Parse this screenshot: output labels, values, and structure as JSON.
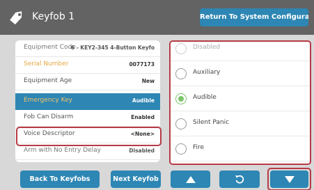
{
  "header": {
    "title": "Keyfob 1",
    "icon": "keyfob-tag-icon",
    "return_label": "Return To System Configuration"
  },
  "details": {
    "rows": [
      {
        "label": "Equipment Code",
        "value": "6 - KEY2-345 4-Button Keyfo"
      },
      {
        "label": "Serial Number",
        "value": "0077173"
      },
      {
        "label": "Equipment Age",
        "value": "New"
      },
      {
        "label": "Emergency Key",
        "value": "Audible"
      },
      {
        "label": "Fob Can Disarm",
        "value": "Enabled"
      },
      {
        "label": "Voice Descriptor",
        "value": "<None>"
      },
      {
        "label": "Arm with No Entry Delay",
        "value": "Disabled"
      }
    ]
  },
  "options": {
    "items": [
      {
        "label": "Disabled",
        "selected": false
      },
      {
        "label": "Auxiliary",
        "selected": false
      },
      {
        "label": "Audible",
        "selected": true
      },
      {
        "label": "Silent Panic",
        "selected": false
      },
      {
        "label": "Fire",
        "selected": false
      }
    ]
  },
  "footer": {
    "back_label": "Back To Keyfobs",
    "next_label": "Next Keyfob",
    "up_icon": "up-arrow-icon",
    "undo_icon": "undo-icon",
    "down_icon": "down-arrow-icon"
  },
  "colors": {
    "header_bg": "#636363",
    "accent_blue": "#2d86b3",
    "highlight_red": "#b73a45",
    "selected_green": "#7ec46a",
    "label_gold": "#e4a73d"
  }
}
